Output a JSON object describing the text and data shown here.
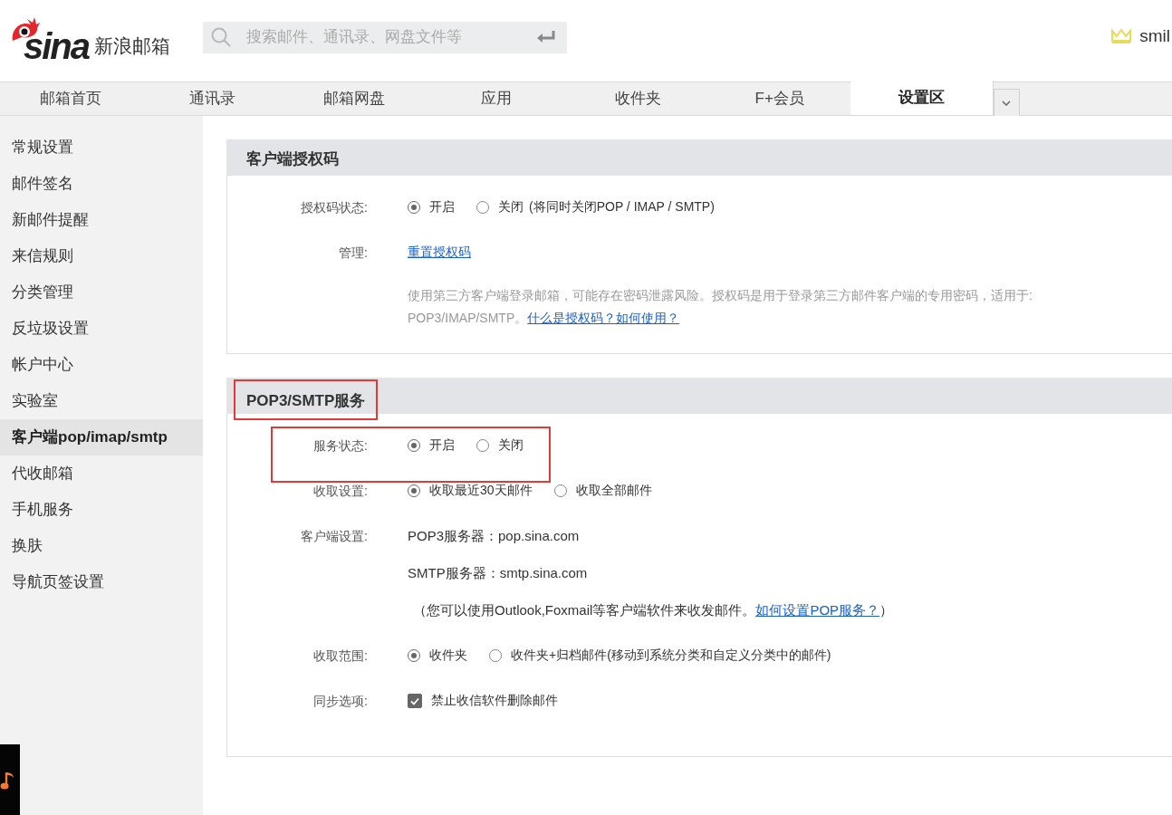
{
  "header": {
    "logo_wordmark": "sina",
    "logo_text": "新浪邮箱",
    "search": {
      "placeholder": "搜索邮件、通讯录、网盘文件等"
    },
    "user": "smil"
  },
  "tabs": [
    {
      "label": "邮箱首页",
      "selected": false
    },
    {
      "label": "通讯录",
      "selected": false
    },
    {
      "label": "邮箱网盘",
      "selected": false
    },
    {
      "label": "应用",
      "selected": false
    },
    {
      "label": "收件夹",
      "selected": false
    },
    {
      "label": "F+会员",
      "selected": false
    },
    {
      "label": "设置区",
      "selected": true
    }
  ],
  "sidebar": {
    "items": [
      {
        "label": "常规设置",
        "selected": false
      },
      {
        "label": "邮件签名",
        "selected": false
      },
      {
        "label": "新邮件提醒",
        "selected": false
      },
      {
        "label": "来信规则",
        "selected": false
      },
      {
        "label": "分类管理",
        "selected": false
      },
      {
        "label": "反垃圾设置",
        "selected": false
      },
      {
        "label": "帐户中心",
        "selected": false
      },
      {
        "label": "实验室",
        "selected": false
      },
      {
        "label": "客户端pop/imap/smtp",
        "selected": true
      },
      {
        "label": "代收邮箱",
        "selected": false
      },
      {
        "label": "手机服务",
        "selected": false
      },
      {
        "label": "换肤",
        "selected": false
      },
      {
        "label": "导航页签设置",
        "selected": false
      }
    ]
  },
  "sections": [
    {
      "title": "客户端授权码",
      "highlighted": false,
      "rows": [
        {
          "kind": "radio",
          "label": "授权码状态:",
          "highlighted": false,
          "options": [
            {
              "label": "开启",
              "selected": true
            },
            {
              "label": "关闭",
              "selected": false
            }
          ],
          "note": "(将同时关闭POP / IMAP / SMTP)"
        },
        {
          "kind": "link",
          "label": "管理:",
          "highlighted": false,
          "link": "重置授权码"
        },
        {
          "kind": "note",
          "highlighted": false,
          "text": "使用第三方客户端登录邮箱，可能存在密码泄露风险。授权码是用于登录第三方邮件客户端的专用密码，适用于: POP3/IMAP/SMTP。",
          "link": "什么是授权码？如何使用？"
        }
      ]
    },
    {
      "title": "POP3/SMTP服务",
      "highlighted": true,
      "rows": [
        {
          "kind": "radio",
          "label": "服务状态:",
          "highlighted": true,
          "options": [
            {
              "label": "开启",
              "selected": true
            },
            {
              "label": "关闭",
              "selected": false
            }
          ]
        },
        {
          "kind": "radio",
          "label": "收取设置:",
          "highlighted": false,
          "options": [
            {
              "label": "收取最近30天邮件",
              "selected": true
            },
            {
              "label": "收取全部邮件",
              "selected": false
            }
          ]
        },
        {
          "kind": "lines",
          "label": "客户端设置:",
          "highlighted": false,
          "lines": [
            "POP3服务器：pop.sina.com",
            "SMTP服务器：smtp.sina.com"
          ],
          "text": "（您可以使用Outlook,Foxmail等客户端软件来收发邮件。",
          "link": "如何设置POP服务？",
          "suffix": "）"
        },
        {
          "kind": "radio",
          "label": "收取范围:",
          "highlighted": false,
          "options": [
            {
              "label": "收件夹",
              "selected": true
            },
            {
              "label": "收件夹+归档邮件(移动到系统分类和自定义分类中的邮件)",
              "selected": false
            }
          ]
        },
        {
          "kind": "checkbox",
          "label": "同步选项:",
          "highlighted": false,
          "option": {
            "label": "禁止收信软件删除邮件",
            "checked": true
          }
        }
      ]
    }
  ]
}
